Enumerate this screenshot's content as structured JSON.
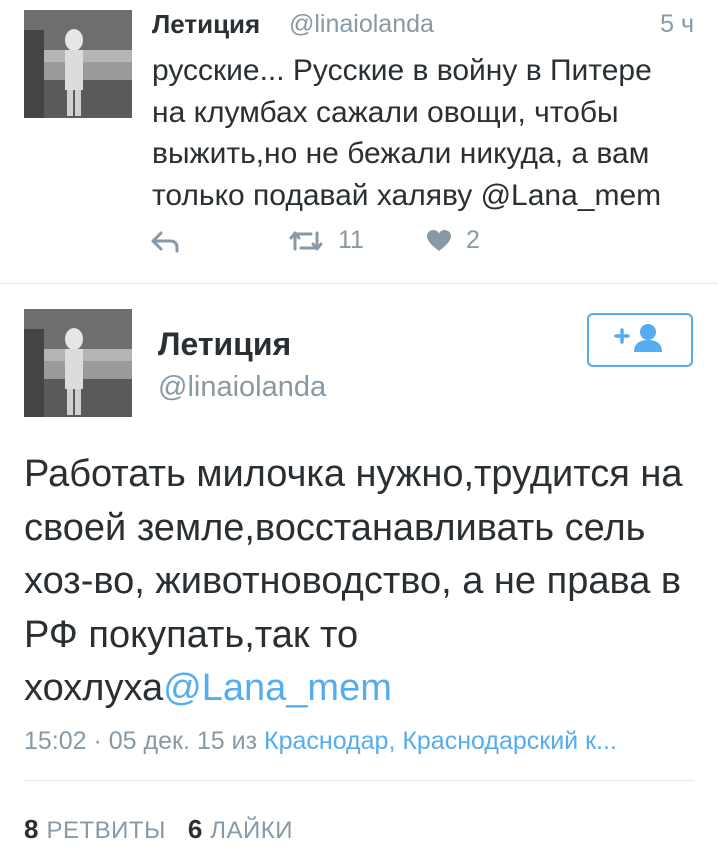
{
  "reply_tweet": {
    "author_name": "Летиция",
    "author_handle": "@linaiolanda",
    "time": "5 ч",
    "text": "русские... Русские в войну в Питере\nна клумбах сажали овощи, чтобы\nвыжить,но не бежали никуда, а вам\nтолько подавай халяву @Lana_mem",
    "retweet_count": "11",
    "like_count": "2",
    "icons": [
      "reply-icon",
      "retweet-icon",
      "heart-icon"
    ]
  },
  "main_tweet": {
    "author_name": "Летиция",
    "author_handle": "@linaiolanda",
    "follow_icon": "follow-user-icon",
    "text_prefix": "Работать милочка нужно,трудится на своей земле,восстанавливать сель хоз-во, животноводство, а не права в РФ покупать,так то хохлуха",
    "mention": "@Lana_mem",
    "timestamp": "15:02 · 05 дек. 15",
    "from_label": "из",
    "location": "Краснодар, Краснодарский к...",
    "retweets_count": "8",
    "retweets_label": "РЕТВИТЫ",
    "likes_count": "6",
    "likes_label": "ЛАЙКИ"
  },
  "colors": {
    "accent": "#55acee",
    "muted": "#8899a6",
    "text": "#292f33",
    "divider": "#e1e8ed"
  }
}
